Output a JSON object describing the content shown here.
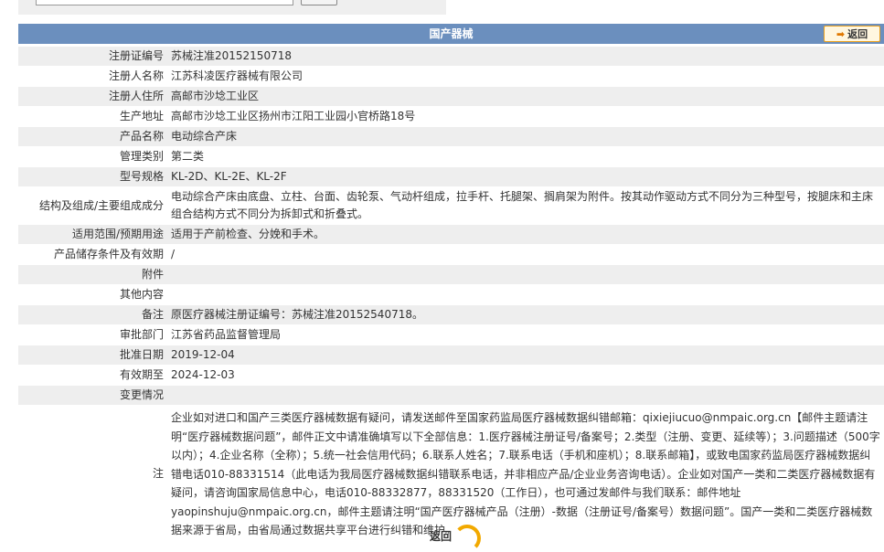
{
  "header": {
    "title": "国产器械",
    "back_label": "返回"
  },
  "rows": [
    {
      "label": "注册证编号",
      "value": "苏械注准20152150718"
    },
    {
      "label": "注册人名称",
      "value": "江苏科凌医疗器械有限公司"
    },
    {
      "label": "注册人住所",
      "value": "高邮市沙埝工业区"
    },
    {
      "label": "生产地址",
      "value": "高邮市沙埝工业区扬州市江阳工业园小官桥路18号"
    },
    {
      "label": "产品名称",
      "value": "电动综合产床"
    },
    {
      "label": "管理类别",
      "value": "第二类"
    },
    {
      "label": "型号规格",
      "value": "KL-2D、KL-2E、KL-2F"
    },
    {
      "label": "结构及组成/主要组成成分",
      "value": "电动综合产床由底盘、立柱、台面、齿轮泵、气动杆组成，拉手杆、托腿架、搁肩架为附件。按其动作驱动方式不同分为三种型号，按腿床和主床组合结构方式不同分为拆卸式和折叠式。"
    },
    {
      "label": "适用范围/预期用途",
      "value": "适用于产前检查、分娩和手术。"
    },
    {
      "label": "产品储存条件及有效期",
      "value": "/"
    },
    {
      "label": "附件",
      "value": ""
    },
    {
      "label": "其他内容",
      "value": ""
    },
    {
      "label": "备注",
      "value": "原医疗器械注册证编号：苏械注准20152540718。"
    },
    {
      "label": "审批部门",
      "value": "江苏省药品监督管理局"
    },
    {
      "label": "批准日期",
      "value": "2019-12-04"
    },
    {
      "label": "有效期至",
      "value": "2024-12-03"
    },
    {
      "label": "变更情况",
      "value": ""
    }
  ],
  "notes": {
    "label": "注",
    "text": "企业如对进口和国产三类医疗器械数据有疑问，请发送邮件至国家药监局医疗器械数据纠错邮箱：qixiejiucuo@nmpaic.org.cn【邮件主题请注明“医疗器械数据问题”，邮件正文中请准确填写以下全部信息：1.医疗器械注册证号/备案号；2.类型（注册、变更、延续等）；3.问题描述（500字以内）；4.企业名称（全称）；5.统一社会信用代码；6.联系人姓名；7.联系电话（手机和座机）；8.联系邮箱】，或致电国家药监局医疗器械数据纠错电话010-88331514（此电话为我局医疗器械数据纠错联系电话，并非相应产品/企业业务咨询电话）。企业如对国产一类和二类医疗器械数据有疑问，请咨询国家局信息中心，电话010-88332877，88331520（工作日），也可通过发邮件与我们联系：邮件地址yaopinshuju@nmpaic.org.cn，邮件主题请注明“国产医疗器械产品（注册）-数据（注册证号/备案号）数据问题”。国产一类和二类医疗器械数据来源于省局，由省局通过数据共享平台进行纠错和维护。"
  },
  "footer": {
    "back_label": "返回"
  },
  "colors": {
    "titlebar": "#6b8fbe",
    "row_alt": "#eeeeee",
    "accent": "#f2a900"
  }
}
